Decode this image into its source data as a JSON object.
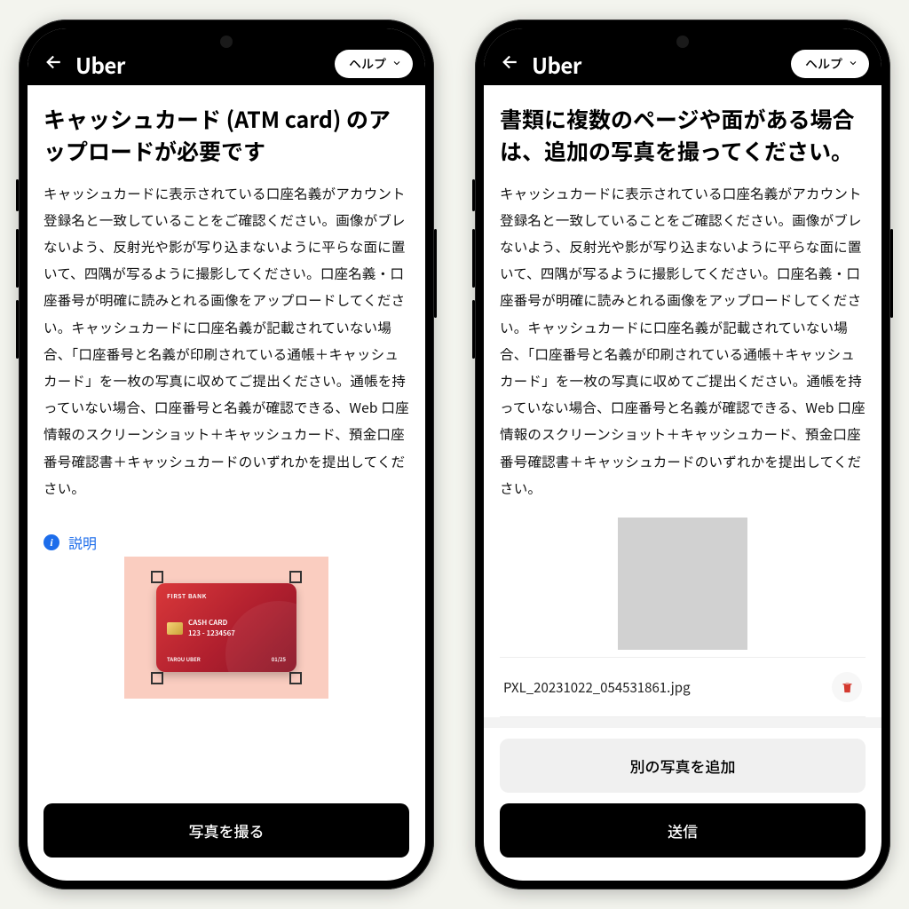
{
  "header": {
    "logo": "Uber",
    "help_label": "ヘルプ"
  },
  "screen1": {
    "title": "キャッシュカード (ATM card) のアップロードが必要です",
    "body": "キャッシュカードに表示されている口座名義がアカウント登録名と一致していることをご確認ください。画像がブレないよう、反射光や影が写り込まないように平らな面に置いて、四隅が写るように撮影してください。口座名義・口座番号が明確に読みとれる画像をアップロードしてください。キャッシュカードに口座名義が記載されていない場合、「口座番号と名義が印刷されている通帳＋キャッシュカード」を一枚の写真に収めてご提出ください。通帳を持っていない場合、口座番号と名義が確認できる、Web 口座情報のスクリーンショット＋キャッシュカード、預金口座番号確認書＋キャッシュカードのいずれかを提出してください。",
    "explain_label": "説明",
    "sample_card": {
      "bank": "FIRST BANK",
      "type": "CASH CARD",
      "number": "123 - 1234567",
      "holder": "TAROU UBER",
      "exp": "01/25"
    },
    "primary_button": "写真を撮る"
  },
  "screen2": {
    "title": "書類に複数のページや面がある場合は、追加の写真を撮ってください。",
    "body": "キャッシュカードに表示されている口座名義がアカウント登録名と一致していることをご確認ください。画像がブレないよう、反射光や影が写り込まないように平らな面に置いて、四隅が写るように撮影してください。口座名義・口座番号が明確に読みとれる画像をアップロードしてください。キャッシュカードに口座名義が記載されていない場合、「口座番号と名義が印刷されている通帳＋キャッシュカード」を一枚の写真に収めてご提出ください。通帳を持っていない場合、口座番号と名義が確認できる、Web 口座情報のスクリーンショット＋キャッシュカード、預金口座番号確認書＋キャッシュカードのいずれかを提出してください。",
    "uploaded_filename": "PXL_20231022_054531861.jpg",
    "secondary_button": "別の写真を追加",
    "primary_button": "送信"
  }
}
